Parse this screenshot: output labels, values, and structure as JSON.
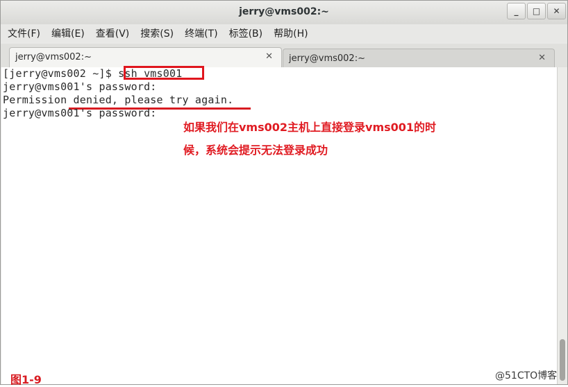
{
  "window": {
    "title": "jerry@vms002:~",
    "buttons": {
      "minimize": "_",
      "maximize": "□",
      "close": "✕"
    }
  },
  "menu": [
    "文件(F)",
    "编辑(E)",
    "查看(V)",
    "搜索(S)",
    "终端(T)",
    "标签(B)",
    "帮助(H)"
  ],
  "tabs": [
    {
      "label": "jerry@vms002:~",
      "close": "✕"
    },
    {
      "label": "jerry@vms002:~",
      "close": "✕"
    }
  ],
  "terminal": {
    "prompt": "[jerry@vms002 ~]$ ",
    "command": "ssh vms001",
    "lines": [
      "jerry@vms001's password:",
      "Permission denied, please try again.",
      "jerry@vms001's password:"
    ]
  },
  "annotation": {
    "line1": "如果我们在vms002主机上直接登录vms001的时",
    "line2": "候，系统会提示无法登录成功"
  },
  "figure_label": "图1-9",
  "watermark": "@51CTO博客",
  "colors": {
    "annotation": "#e01b22",
    "terminal_bg": "#ffffff"
  }
}
